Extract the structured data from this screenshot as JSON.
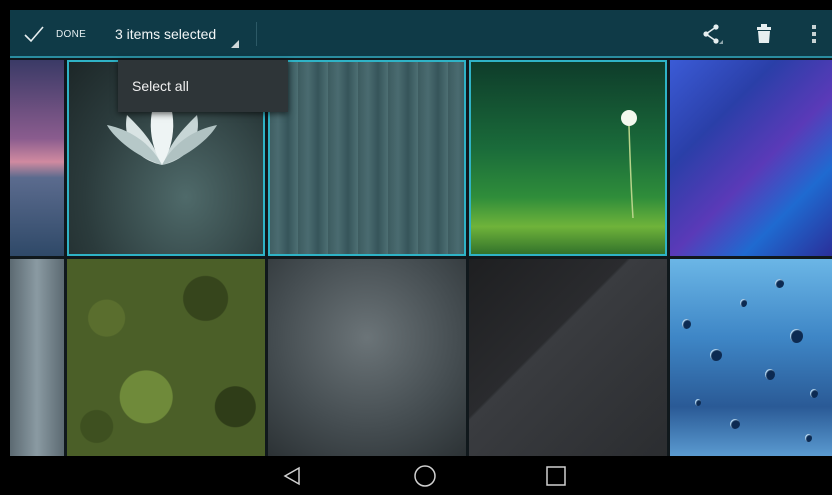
{
  "action_bar": {
    "done_label": "DONE",
    "selection_title": "3 items selected",
    "icons": [
      "check-icon",
      "share-icon",
      "trash-icon",
      "overflow-menu-icon"
    ]
  },
  "popup_menu": {
    "items": [
      {
        "label": "Select all"
      }
    ]
  },
  "grid": {
    "tiles": [
      {
        "name": "lake-wallpaper",
        "selected": false
      },
      {
        "name": "lotus-wallpaper",
        "selected": true
      },
      {
        "name": "wood-wallpaper",
        "selected": true
      },
      {
        "name": "dandelion-wallpaper",
        "selected": true
      },
      {
        "name": "blue-polygon-wallpaper",
        "selected": false
      },
      {
        "name": "steel-wallpaper",
        "selected": false
      },
      {
        "name": "camouflage-wallpaper",
        "selected": false
      },
      {
        "name": "metal-mesh-wallpaper",
        "selected": false
      },
      {
        "name": "carbon-wallpaper",
        "selected": false
      },
      {
        "name": "raindrops-wallpaper",
        "selected": false
      }
    ]
  },
  "nav_bar": {
    "icons": [
      "back-icon",
      "home-icon",
      "recents-icon"
    ]
  },
  "colors": {
    "action_bar": "#0f3a47",
    "accent": "#2fb3c6",
    "popup": "#2e3538"
  }
}
